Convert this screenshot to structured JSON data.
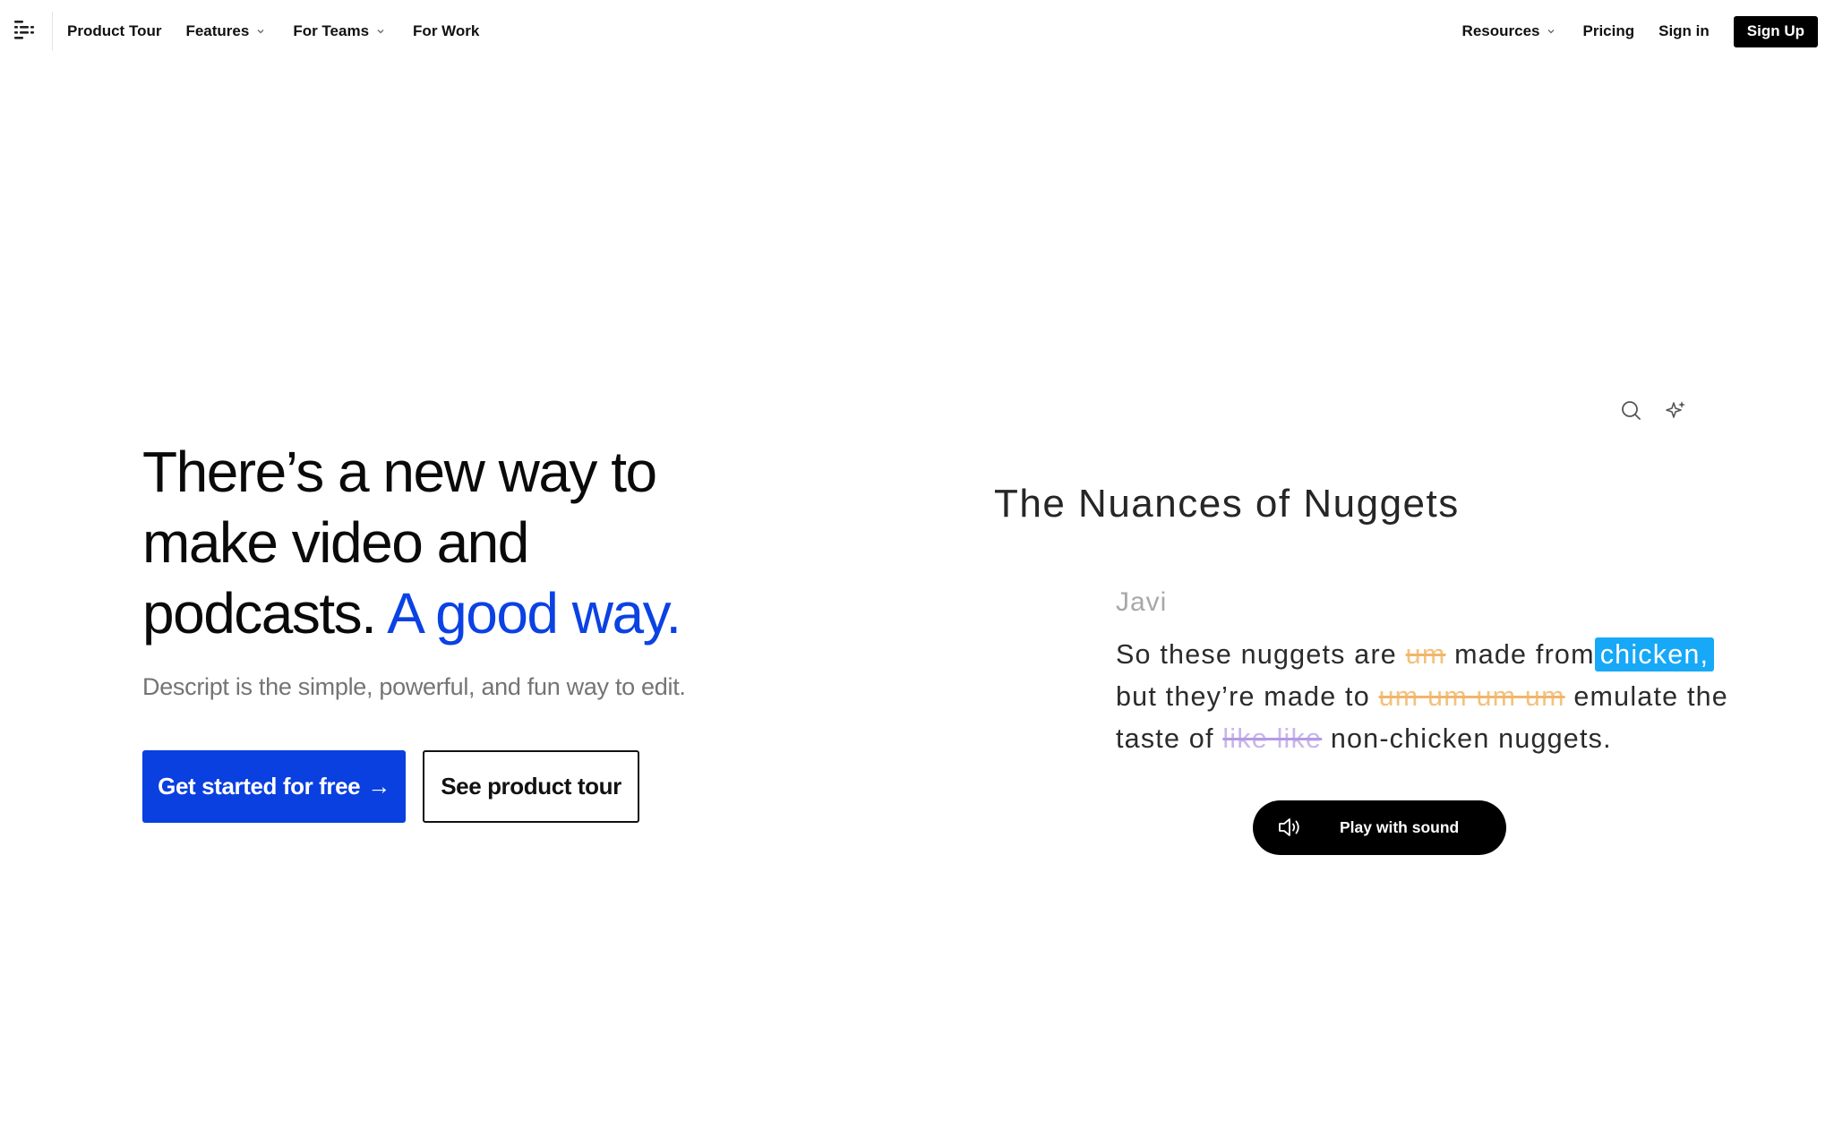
{
  "nav": {
    "logo_icon": "descript-logo-icon",
    "left_items": [
      {
        "label": "Product Tour",
        "has_dropdown": false
      },
      {
        "label": "Features",
        "has_dropdown": true
      },
      {
        "label": "For Teams",
        "has_dropdown": true
      },
      {
        "label": "For Work",
        "has_dropdown": false
      }
    ],
    "right_items": [
      {
        "label": "Resources",
        "has_dropdown": true
      },
      {
        "label": "Pricing",
        "has_dropdown": false
      },
      {
        "label": "Sign in",
        "has_dropdown": false
      }
    ],
    "signup_label": "Sign Up"
  },
  "hero": {
    "title_line1": "There’s a new way to",
    "title_line2": "make video and",
    "title_line3": "podcasts.",
    "title_accent": "A good way.",
    "subtitle": "Descript is the simple, powerful, and fun way to edit.",
    "cta_primary": "Get started for free",
    "cta_primary_arrow": "→",
    "cta_secondary": "See product tour"
  },
  "demo": {
    "tool_icons": [
      "search-icon",
      "sparkle-icon"
    ],
    "doc_title": "The Nuances of Nuggets",
    "speaker": "Javi",
    "line1": {
      "a": "So these nuggets are",
      "filler": "um",
      "b": "made from",
      "highlight": "chicken,"
    },
    "line2": {
      "a": "but they’re made to",
      "filler": "um um um um",
      "b": "emulate the"
    },
    "line3": {
      "a": "taste of",
      "repeat": "like like",
      "b": "non-chicken nuggets."
    },
    "play_label": "Play with sound",
    "play_icon": "volume-icon"
  },
  "colors": {
    "accent_blue": "#0b42e4",
    "filler_strike": "#f3c27e",
    "repeat_strike": "#c9b6ec",
    "highlight": "#17a8f7"
  }
}
